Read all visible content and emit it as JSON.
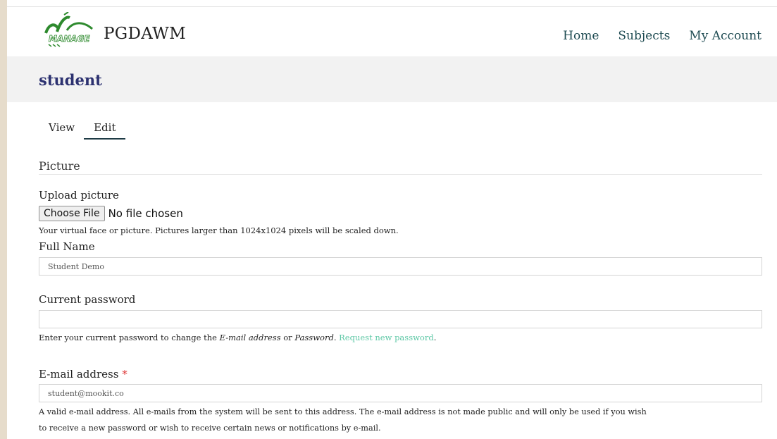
{
  "site": {
    "name": "PGDAWM",
    "logo_text": "MANAGE"
  },
  "nav": {
    "items": [
      "Home",
      "Subjects",
      "My Account"
    ]
  },
  "page": {
    "title": "student"
  },
  "tabs": {
    "view": "View",
    "edit": "Edit"
  },
  "picture": {
    "legend": "Picture",
    "upload_label": "Upload picture",
    "choose_button": "Choose File",
    "no_file": "No file chosen",
    "description": "Your virtual face or picture. Pictures larger than 1024x1024 pixels will be scaled down."
  },
  "full_name": {
    "label": "Full Name",
    "value": "Student Demo"
  },
  "current_password": {
    "label": "Current password",
    "value": "",
    "desc_prefix": "Enter your current password to change the ",
    "desc_em1": "E-mail address",
    "desc_or": " or ",
    "desc_em2": "Password",
    "desc_dot": ". ",
    "desc_link": "Request new password",
    "desc_end": "."
  },
  "email": {
    "label": "E-mail address",
    "required_mark": "*",
    "value": "student@mookit.co",
    "desc_line1": "A valid e-mail address. All e-mails from the system will be sent to this address. The e-mail address is not made public and will only be used if you wish",
    "desc_line2": "to receive a new password or wish to receive certain news or notifications by e-mail."
  },
  "colors": {
    "accent": "#1e4b52",
    "title": "#2c3170",
    "link": "#5ec8a6",
    "logo_green": "#2e8a2e",
    "stripe": "#e6dccb"
  }
}
